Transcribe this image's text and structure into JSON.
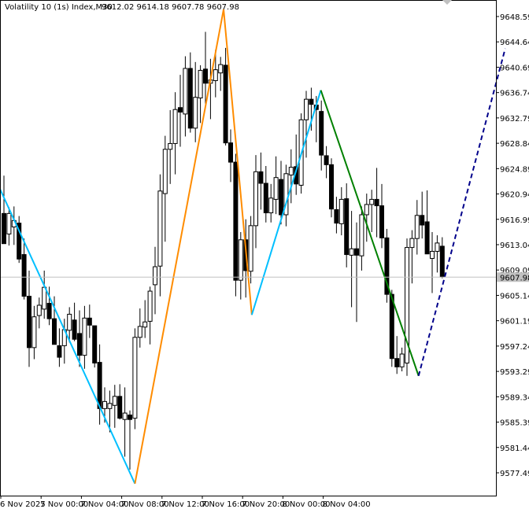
{
  "chart_header": {
    "symbol": "Volatility 10 (1s) Index,M30",
    "ohlc": "9612.02 9614.18 9607.78 9607.98"
  },
  "chart_data": {
    "type": "candlestick",
    "symbol": "Volatility 10 (1s) Index",
    "timeframe": "M30",
    "open": 9612.02,
    "high": 9614.18,
    "low": 9607.78,
    "close": 9607.98,
    "current_price": "9607.98",
    "y_ticks": [
      "9648.59",
      "9644.64",
      "9640.69",
      "9636.74",
      "9632.79",
      "9628.84",
      "9624.89",
      "9620.94",
      "9616.99",
      "9613.04",
      "9609.09",
      "9605.14",
      "9601.19",
      "9597.24",
      "9593.29",
      "9589.34",
      "9585.39",
      "9581.44",
      "9577.49"
    ],
    "x_ticks": [
      "6 Nov 2025",
      "7 Nov 00:00",
      "7 Nov 04:00",
      "7 Nov 08:00",
      "7 Nov 12:00",
      "7 Nov 16:00",
      "7 Nov 20:00",
      "8 Nov 00:00",
      "8 Nov 04:00"
    ],
    "candles": [
      {
        "o": 9617.9,
        "h": 9623.8,
        "l": 9613.2,
        "c": 9613.2
      },
      {
        "o": 9614.7,
        "h": 9618.9,
        "l": 9612.9,
        "c": 9617.9
      },
      {
        "o": 9615.8,
        "h": 9619.0,
        "l": 9613.0,
        "c": 9616.8
      },
      {
        "o": 9616.4,
        "h": 9617.5,
        "l": 9610.2,
        "c": 9610.8
      },
      {
        "o": 9611.5,
        "h": 9614.0,
        "l": 9604.5,
        "c": 9605.0
      },
      {
        "o": 9605.0,
        "h": 9609.0,
        "l": 9594.0,
        "c": 9597.0
      },
      {
        "o": 9597.0,
        "h": 9603.5,
        "l": 9595.2,
        "c": 9601.8
      },
      {
        "o": 9602.0,
        "h": 9604.8,
        "l": 9600.0,
        "c": 9603.6
      },
      {
        "o": 9603.0,
        "h": 9609.0,
        "l": 9601.5,
        "c": 9606.4
      },
      {
        "o": 9603.9,
        "h": 9606.5,
        "l": 9600.5,
        "c": 9601.5
      },
      {
        "o": 9601.5,
        "h": 9605.0,
        "l": 9597.5,
        "c": 9597.5
      },
      {
        "o": 9597.3,
        "h": 9600.0,
        "l": 9594.0,
        "c": 9595.5
      },
      {
        "o": 9597.3,
        "h": 9601.5,
        "l": 9594.5,
        "c": 9599.8
      },
      {
        "o": 9599.7,
        "h": 9603.3,
        "l": 9597.8,
        "c": 9602.2
      },
      {
        "o": 9601.3,
        "h": 9604.0,
        "l": 9598.0,
        "c": 9598.3
      },
      {
        "o": 9599.2,
        "h": 9602.8,
        "l": 9594.0,
        "c": 9595.8
      },
      {
        "o": 9595.8,
        "h": 9603.5,
        "l": 9593.7,
        "c": 9601.6
      },
      {
        "o": 9601.6,
        "h": 9603.7,
        "l": 9598.5,
        "c": 9600.5
      },
      {
        "o": 9600.4,
        "h": 9600.4,
        "l": 9593.9,
        "c": 9594.6
      },
      {
        "o": 9594.7,
        "h": 9597.5,
        "l": 9585.0,
        "c": 9587.5
      },
      {
        "o": 9587.5,
        "h": 9590.8,
        "l": 9585.3,
        "c": 9588.6
      },
      {
        "o": 9587.5,
        "h": 9590.3,
        "l": 9583.8,
        "c": 9588.3
      },
      {
        "o": 9588.0,
        "h": 9591.2,
        "l": 9584.5,
        "c": 9589.4
      },
      {
        "o": 9589.4,
        "h": 9591.3,
        "l": 9585.8,
        "c": 9586.0
      },
      {
        "o": 9585.8,
        "h": 9590.8,
        "l": 9580.0,
        "c": 9586.8
      },
      {
        "o": 9586.5,
        "h": 9587.2,
        "l": 9578.0,
        "c": 9585.8
      },
      {
        "o": 9586.0,
        "h": 9600.0,
        "l": 9584.3,
        "c": 9598.6
      },
      {
        "o": 9598.6,
        "h": 9603.1,
        "l": 9597.0,
        "c": 9600.3
      },
      {
        "o": 9600.2,
        "h": 9604.4,
        "l": 9598.5,
        "c": 9601.0
      },
      {
        "o": 9601.1,
        "h": 9606.5,
        "l": 9597.5,
        "c": 9605.8
      },
      {
        "o": 9606.8,
        "h": 9612.7,
        "l": 9602.2,
        "c": 9609.6
      },
      {
        "o": 9609.7,
        "h": 9624.0,
        "l": 9605.0,
        "c": 9621.4
      },
      {
        "o": 9621.0,
        "h": 9630.0,
        "l": 9613.5,
        "c": 9627.9
      },
      {
        "o": 9627.9,
        "h": 9634.0,
        "l": 9622.5,
        "c": 9628.8
      },
      {
        "o": 9628.8,
        "h": 9636.8,
        "l": 9624.0,
        "c": 9634.1
      },
      {
        "o": 9634.4,
        "h": 9639.5,
        "l": 9628.3,
        "c": 9633.7
      },
      {
        "o": 9633.4,
        "h": 9642.4,
        "l": 9629.9,
        "c": 9640.5
      },
      {
        "o": 9640.5,
        "h": 9643.0,
        "l": 9630.5,
        "c": 9631.2
      },
      {
        "o": 9631.2,
        "h": 9641.5,
        "l": 9629.0,
        "c": 9636.0
      },
      {
        "o": 9635.9,
        "h": 9641.0,
        "l": 9632.0,
        "c": 9640.2
      },
      {
        "o": 9640.4,
        "h": 9646.2,
        "l": 9634.5,
        "c": 9638.2
      },
      {
        "o": 9638.2,
        "h": 9642.0,
        "l": 9632.6,
        "c": 9638.7
      },
      {
        "o": 9638.6,
        "h": 9643.4,
        "l": 9636.0,
        "c": 9640.3
      },
      {
        "o": 9639.8,
        "h": 9642.3,
        "l": 9637.0,
        "c": 9641.1
      },
      {
        "o": 9641.0,
        "h": 9643.7,
        "l": 9628.5,
        "c": 9628.9
      },
      {
        "o": 9628.9,
        "h": 9631.0,
        "l": 9622.8,
        "c": 9625.9
      },
      {
        "o": 9625.9,
        "h": 9627.2,
        "l": 9605.0,
        "c": 9607.5
      },
      {
        "o": 9607.5,
        "h": 9615.0,
        "l": 9604.5,
        "c": 9613.8
      },
      {
        "o": 9613.8,
        "h": 9617.0,
        "l": 9604.8,
        "c": 9609.0
      },
      {
        "o": 9608.9,
        "h": 9617.5,
        "l": 9607.0,
        "c": 9616.0
      },
      {
        "o": 9616.0,
        "h": 9627.0,
        "l": 9612.5,
        "c": 9624.4
      },
      {
        "o": 9624.4,
        "h": 9627.4,
        "l": 9618.5,
        "c": 9622.6
      },
      {
        "o": 9622.6,
        "h": 9625.3,
        "l": 9616.5,
        "c": 9618.0
      },
      {
        "o": 9618.0,
        "h": 9622.5,
        "l": 9616.5,
        "c": 9620.3
      },
      {
        "o": 9620.1,
        "h": 9626.8,
        "l": 9617.8,
        "c": 9623.5
      },
      {
        "o": 9623.2,
        "h": 9626.1,
        "l": 9616.2,
        "c": 9617.7
      },
      {
        "o": 9617.7,
        "h": 9625.5,
        "l": 9615.9,
        "c": 9624.1
      },
      {
        "o": 9623.9,
        "h": 9627.9,
        "l": 9619.5,
        "c": 9625.1
      },
      {
        "o": 9625.2,
        "h": 9630.2,
        "l": 9620.8,
        "c": 9622.5
      },
      {
        "o": 9622.3,
        "h": 9633.5,
        "l": 9621.0,
        "c": 9632.5
      },
      {
        "o": 9632.5,
        "h": 9637.0,
        "l": 9626.6,
        "c": 9635.7
      },
      {
        "o": 9635.7,
        "h": 9637.5,
        "l": 9630.8,
        "c": 9634.9
      },
      {
        "o": 9634.8,
        "h": 9636.2,
        "l": 9629.0,
        "c": 9634.1
      },
      {
        "o": 9633.8,
        "h": 9635.5,
        "l": 9624.6,
        "c": 9627.0
      },
      {
        "o": 9626.9,
        "h": 9628.4,
        "l": 9623.4,
        "c": 9625.5
      },
      {
        "o": 9625.5,
        "h": 9626.5,
        "l": 9617.3,
        "c": 9618.6
      },
      {
        "o": 9618.5,
        "h": 9620.5,
        "l": 9614.8,
        "c": 9616.4
      },
      {
        "o": 9616.3,
        "h": 9622.0,
        "l": 9614.5,
        "c": 9620.1
      },
      {
        "o": 9620.2,
        "h": 9622.6,
        "l": 9609.5,
        "c": 9611.5
      },
      {
        "o": 9611.4,
        "h": 9618.3,
        "l": 9603.3,
        "c": 9612.4
      },
      {
        "o": 9612.4,
        "h": 9616.5,
        "l": 9601.0,
        "c": 9611.4
      },
      {
        "o": 9611.3,
        "h": 9619.0,
        "l": 9609.0,
        "c": 9617.7
      },
      {
        "o": 9617.7,
        "h": 9621.0,
        "l": 9613.5,
        "c": 9619.3
      },
      {
        "o": 9619.3,
        "h": 9621.6,
        "l": 9615.0,
        "c": 9620.1
      },
      {
        "o": 9620.1,
        "h": 9625.0,
        "l": 9614.2,
        "c": 9619.1
      },
      {
        "o": 9619.1,
        "h": 9622.5,
        "l": 9612.5,
        "c": 9614.1
      },
      {
        "o": 9614.1,
        "h": 9615.5,
        "l": 9604.0,
        "c": 9605.3
      },
      {
        "o": 9605.3,
        "h": 9606.0,
        "l": 9594.0,
        "c": 9595.3
      },
      {
        "o": 9595.3,
        "h": 9598.8,
        "l": 9592.9,
        "c": 9594.0
      },
      {
        "o": 9594.0,
        "h": 9597.0,
        "l": 9593.3,
        "c": 9596.0
      },
      {
        "o": 9594.6,
        "h": 9614.0,
        "l": 9592.6,
        "c": 9612.6
      },
      {
        "o": 9612.6,
        "h": 9615.3,
        "l": 9607.0,
        "c": 9614.0
      },
      {
        "o": 9614.0,
        "h": 9620.0,
        "l": 9611.5,
        "c": 9617.6
      },
      {
        "o": 9617.6,
        "h": 9621.3,
        "l": 9614.0,
        "c": 9616.1
      },
      {
        "o": 9616.6,
        "h": 9621.5,
        "l": 9612.0,
        "c": 9611.6
      },
      {
        "o": 9610.9,
        "h": 9615.0,
        "l": 9605.5,
        "c": 9612.0
      },
      {
        "o": 9612.0,
        "h": 9614.5,
        "l": 9608.7,
        "c": 9613.3
      },
      {
        "o": 9612.8,
        "h": 9614.2,
        "l": 9607.8,
        "c": 9608.0
      }
    ],
    "zigzag_lines": [
      {
        "color": "#00bfff",
        "points": [
          [
            -2,
            9623.8
          ],
          [
            26,
            9575.8
          ]
        ]
      },
      {
        "color": "#ff8c00",
        "points": [
          [
            26,
            9575.8
          ],
          [
            43.6,
            9649.7
          ]
        ]
      },
      {
        "color": "#ff8c00",
        "points": [
          [
            43.6,
            9649.7
          ],
          [
            49.2,
            9602.1
          ]
        ]
      },
      {
        "color": "#00bfff",
        "points": [
          [
            49.2,
            9602.1
          ],
          [
            62.9,
            9637.1
          ]
        ]
      },
      {
        "color": "#008000",
        "points": [
          [
            62.9,
            9637.1
          ],
          [
            82.3,
            9592.6
          ]
        ]
      }
    ],
    "projection_line": {
      "color": "#00008b",
      "dashed": true,
      "points": [
        [
          82.3,
          9592.6
        ],
        [
          99.5,
          9643.6
        ]
      ]
    },
    "grid": false,
    "ylim": [
      9574.0,
      9650.0
    ]
  }
}
